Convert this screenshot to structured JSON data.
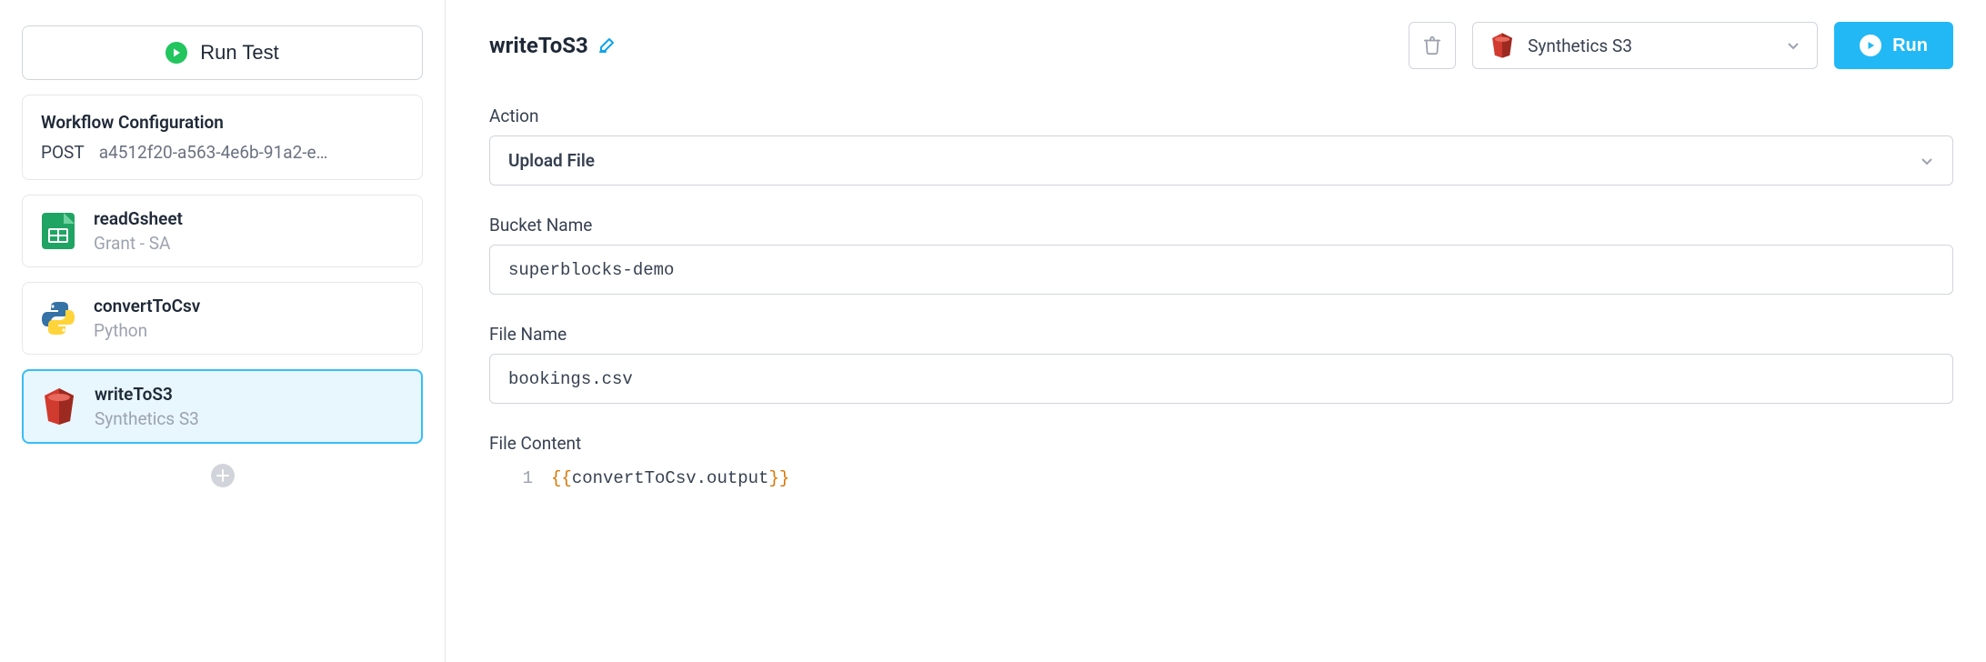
{
  "sidebar": {
    "run_test_label": "Run Test",
    "workflow_config": {
      "title": "Workflow Configuration",
      "method": "POST",
      "id": "a4512f20-a563-4e6b-91a2-e…"
    },
    "steps": [
      {
        "title": "readGsheet",
        "subtitle": "Grant - SA",
        "icon": "gsheet",
        "selected": false
      },
      {
        "title": "convertToCsv",
        "subtitle": "Python",
        "icon": "python",
        "selected": false
      },
      {
        "title": "writeToS3",
        "subtitle": "Synthetics S3",
        "icon": "aws-s3",
        "selected": true
      }
    ]
  },
  "main": {
    "heading": "writeToS3",
    "resource_label": "Synthetics S3",
    "run_label": "Run",
    "fields": {
      "action": {
        "label": "Action",
        "value": "Upload File"
      },
      "bucket_name": {
        "label": "Bucket Name",
        "value": "superblocks-demo"
      },
      "file_name": {
        "label": "File Name",
        "value": "bookings.csv"
      },
      "file_content": {
        "label": "File Content"
      }
    },
    "code": {
      "line_number": "1",
      "open_brace": "{{",
      "expression": "convertToCsv.output",
      "close_brace": "}}"
    }
  }
}
